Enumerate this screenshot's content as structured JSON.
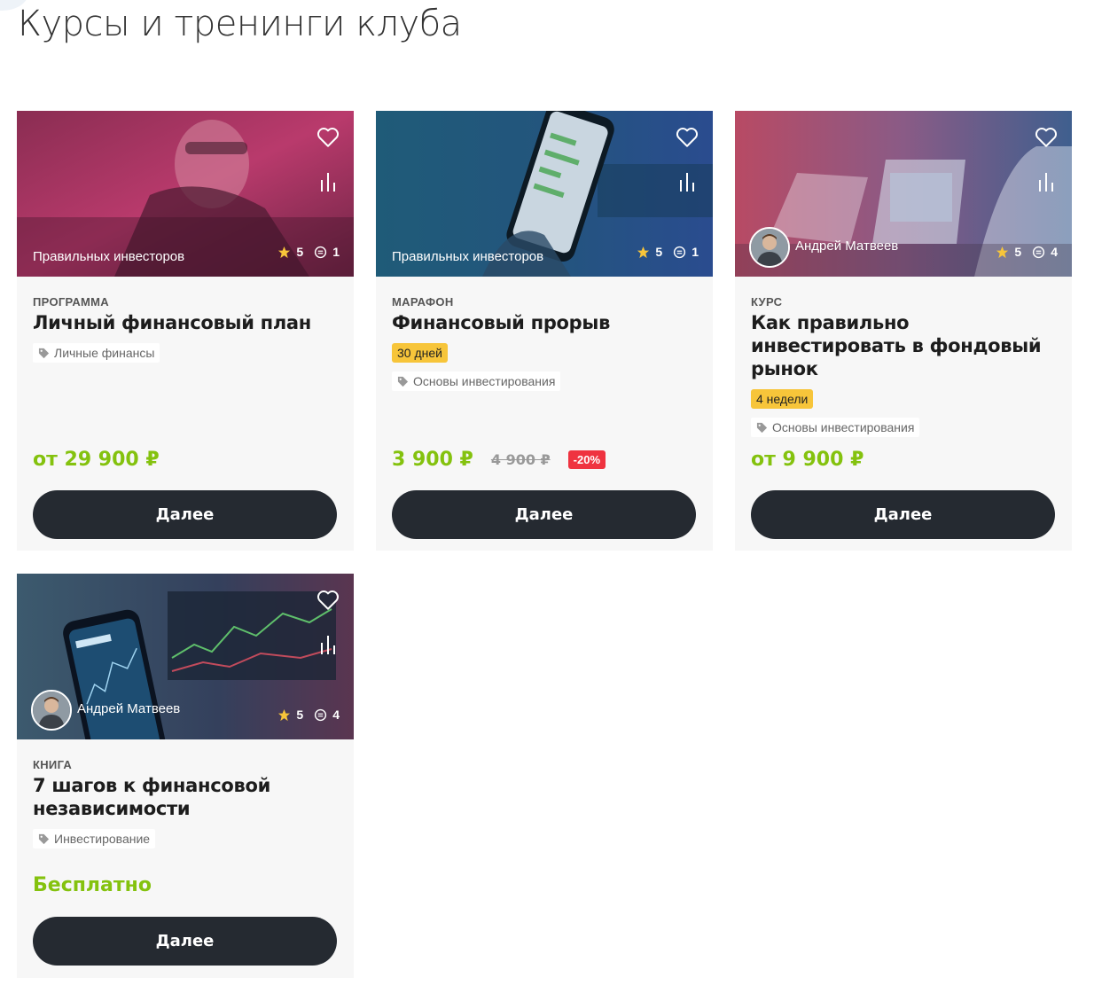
{
  "page": {
    "title": "Курсы и тренинги клуба"
  },
  "colors": {
    "price": "#84c20e",
    "button": "#252a31",
    "badge": "#f7c53a",
    "discount": "#ef3340"
  },
  "cards": [
    {
      "author": "Правильных инвесторов",
      "rating": "5",
      "comments": "1",
      "type": "ПРОГРАММА",
      "title": "Личный финансовый план",
      "duration": "",
      "tag": "Личные финансы",
      "price": "от 29 900 ₽",
      "old_price": "",
      "discount": "",
      "button": "Далее"
    },
    {
      "author": "Правильных инвесторов",
      "rating": "5",
      "comments": "1",
      "type": "МАРАФОН",
      "title": "Финансовый прорыв",
      "duration": "30 дней",
      "tag": "Основы инвестирования",
      "price": "3 900 ₽",
      "old_price": "4 900 ₽",
      "discount": "-20%",
      "button": "Далее"
    },
    {
      "author": "Андрей Матвеев",
      "rating": "5",
      "comments": "4",
      "type": "КУРС",
      "title": "Как правильно инвестировать в фондовый рынок",
      "duration": "4 недели",
      "tag": "Основы инвестирования",
      "price": "от 9 900 ₽",
      "old_price": "",
      "discount": "",
      "button": "Далее"
    },
    {
      "author": "Андрей Матвеев",
      "rating": "5",
      "comments": "4",
      "type": "КНИГА",
      "title": "7 шагов к финансовой независимости",
      "duration": "",
      "tag": "Инвестирование",
      "price": "Бесплатно",
      "old_price": "",
      "discount": "",
      "button": "Далее"
    }
  ]
}
